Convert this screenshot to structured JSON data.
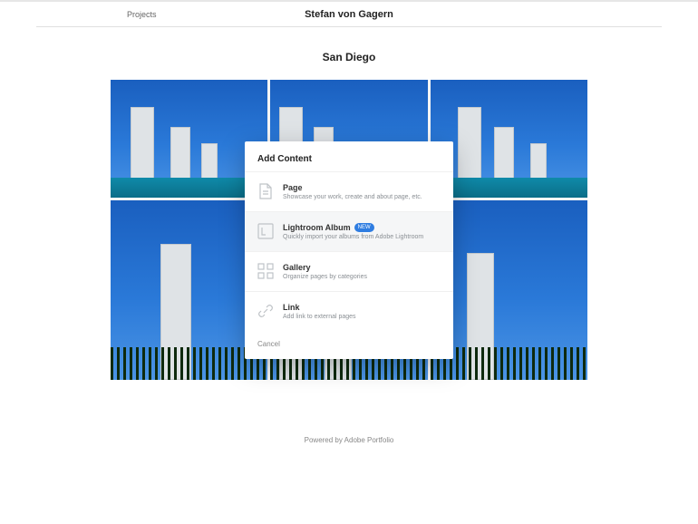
{
  "header": {
    "projects_link": "Projects",
    "site_title": "Stefan von Gagern"
  },
  "page": {
    "title": "San Diego"
  },
  "modal": {
    "heading": "Add Content",
    "options": [
      {
        "title": "Page",
        "desc": "Showcase your work, create and about page, etc."
      },
      {
        "title": "Lightroom Album",
        "badge": "NEW",
        "desc": "Quickly import your albums from Adobe Lightroom"
      },
      {
        "title": "Gallery",
        "desc": "Organize pages by categories"
      },
      {
        "title": "Link",
        "desc": "Add link to external pages"
      }
    ],
    "cancel": "Cancel"
  },
  "footer": {
    "text": "Powered by Adobe Portfolio"
  }
}
